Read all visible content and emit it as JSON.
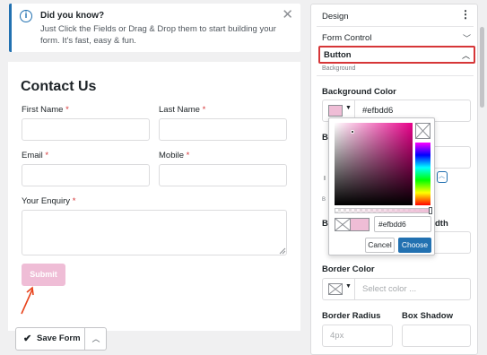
{
  "notice": {
    "title": "Did you know?",
    "text": "Just Click the Fields or Drag & Drop them to start building your form. It's fast, easy & fun.",
    "info_icon": "info-icon",
    "close_icon": "close-icon"
  },
  "form": {
    "title": "Contact Us",
    "first_name_label": "First Name",
    "last_name_label": "Last Name",
    "email_label": "Email",
    "mobile_label": "Mobile",
    "enquiry_label": "Your Enquiry",
    "required_mark": "*",
    "submit_label": "Submit",
    "submit_color": "#efbdd6"
  },
  "save_form": {
    "label": "Save Form",
    "check_icon": "check-icon",
    "caret_icon": "chevron-up-icon"
  },
  "panel": {
    "title": "Design",
    "form_control_label": "Form Control",
    "button_section_label": "Button",
    "background_sub_label": "Background",
    "background_color_label": "Background Color",
    "background_color_value": "#efbdd6",
    "hidden_label_fragment_b1": "B",
    "hidden_label_fragment_b2": "B",
    "hidden_label_fragment_dth": "dth",
    "hidden_fragment_i": "I",
    "hidden_fragment_b3": "B",
    "border_color_label": "Border Color",
    "border_color_placeholder": "Select color ...",
    "border_radius_label": "Border Radius",
    "box_shadow_label": "Box Shadow",
    "border_radius_placeholder": "4px"
  },
  "picker": {
    "hex_value": "#efbdd6",
    "cancel_label": "Cancel",
    "choose_label": "Choose",
    "accent_color": "#2271b1"
  },
  "colors": {
    "highlight_border": "#d63638",
    "arrow": "#e8431c"
  }
}
